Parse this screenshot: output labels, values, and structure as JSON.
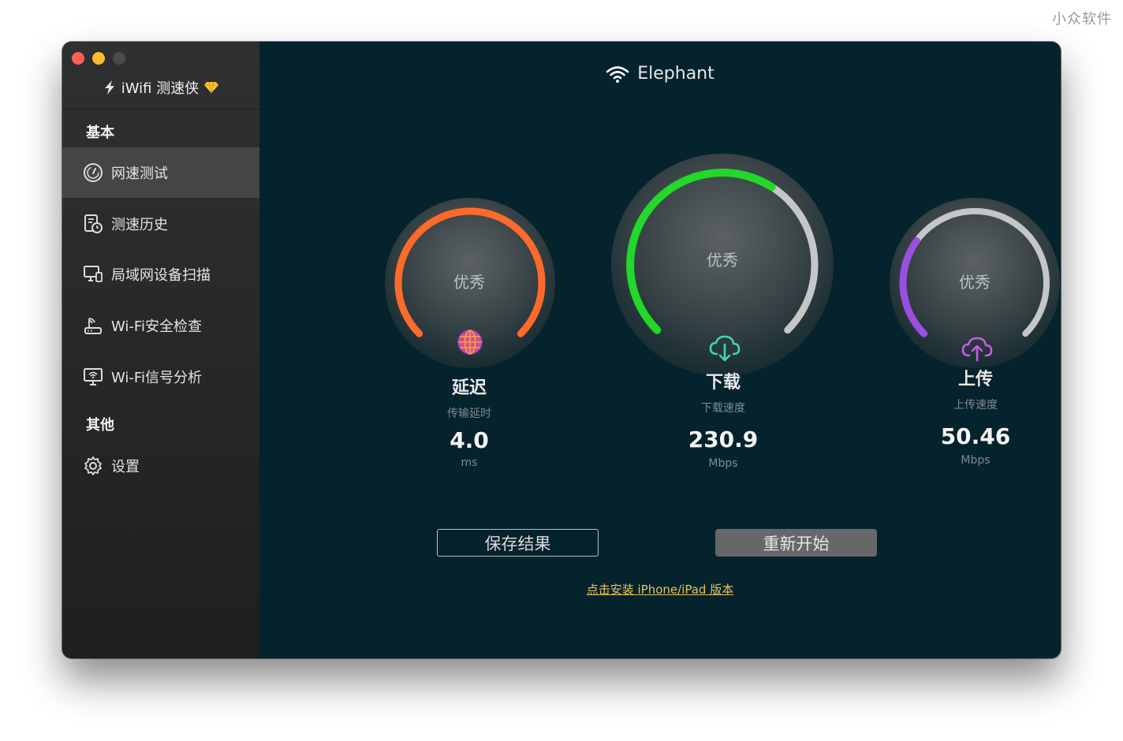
{
  "watermark": "小众软件",
  "app": {
    "title": "iWifi 测速侠"
  },
  "sidebar": {
    "section_basic": "基本",
    "section_other": "其他",
    "items": [
      {
        "label": "网速测试",
        "icon": "speedometer-icon",
        "active": true
      },
      {
        "label": "测速历史",
        "icon": "history-icon"
      },
      {
        "label": "局域网设备扫描",
        "icon": "devices-icon"
      },
      {
        "label": "Wi-Fi安全检查",
        "icon": "router-icon"
      },
      {
        "label": "Wi-Fi信号分析",
        "icon": "signal-monitor-icon"
      },
      {
        "label": "设置",
        "icon": "gear-icon"
      }
    ]
  },
  "network": {
    "ssid": "Elephant"
  },
  "gauges": {
    "latency": {
      "rating": "优秀",
      "name": "延迟",
      "sub": "传输延时",
      "value": "4.0",
      "unit": "ms",
      "color": "#ff6a2b",
      "fill": 1.0
    },
    "download": {
      "rating": "优秀",
      "name": "下载",
      "sub": "下载速度",
      "value": "230.9",
      "unit": "Mbps",
      "color": "#22d82a",
      "fill": 0.62
    },
    "upload": {
      "rating": "优秀",
      "name": "上传",
      "sub": "上传速度",
      "value": "50.46",
      "unit": "Mbps",
      "color": "#9b4fe0",
      "fill": 0.3
    }
  },
  "actions": {
    "save": "保存结果",
    "restart": "重新开始",
    "install_link": "点击安装 iPhone/iPad 版本"
  }
}
